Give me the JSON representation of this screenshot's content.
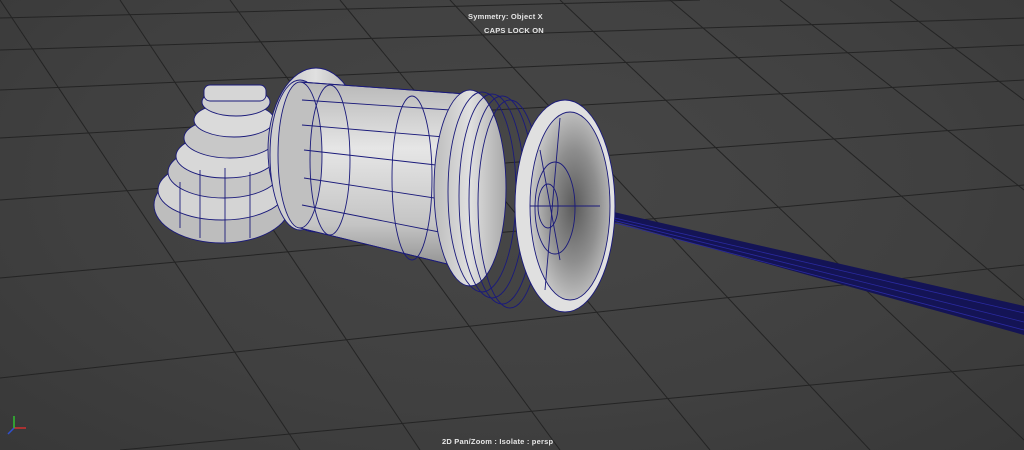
{
  "viewport": {
    "symmetry_text": "Symmetry: Object X",
    "capslock_text": "CAPS LOCK ON",
    "camera_text": "2D Pan/Zoom : Isolate : persp"
  },
  "colors": {
    "background": "#404040",
    "grid": "#222222",
    "wireframe": "#1a1a7a",
    "mesh_light": "#d8d8d8",
    "mesh_shadow": "#8a8a8a",
    "axis_x": "#d03030",
    "axis_y": "#30c030",
    "axis_z": "#3050d0"
  },
  "icons": {
    "axis_gizmo": "xyz-axis-icon"
  }
}
